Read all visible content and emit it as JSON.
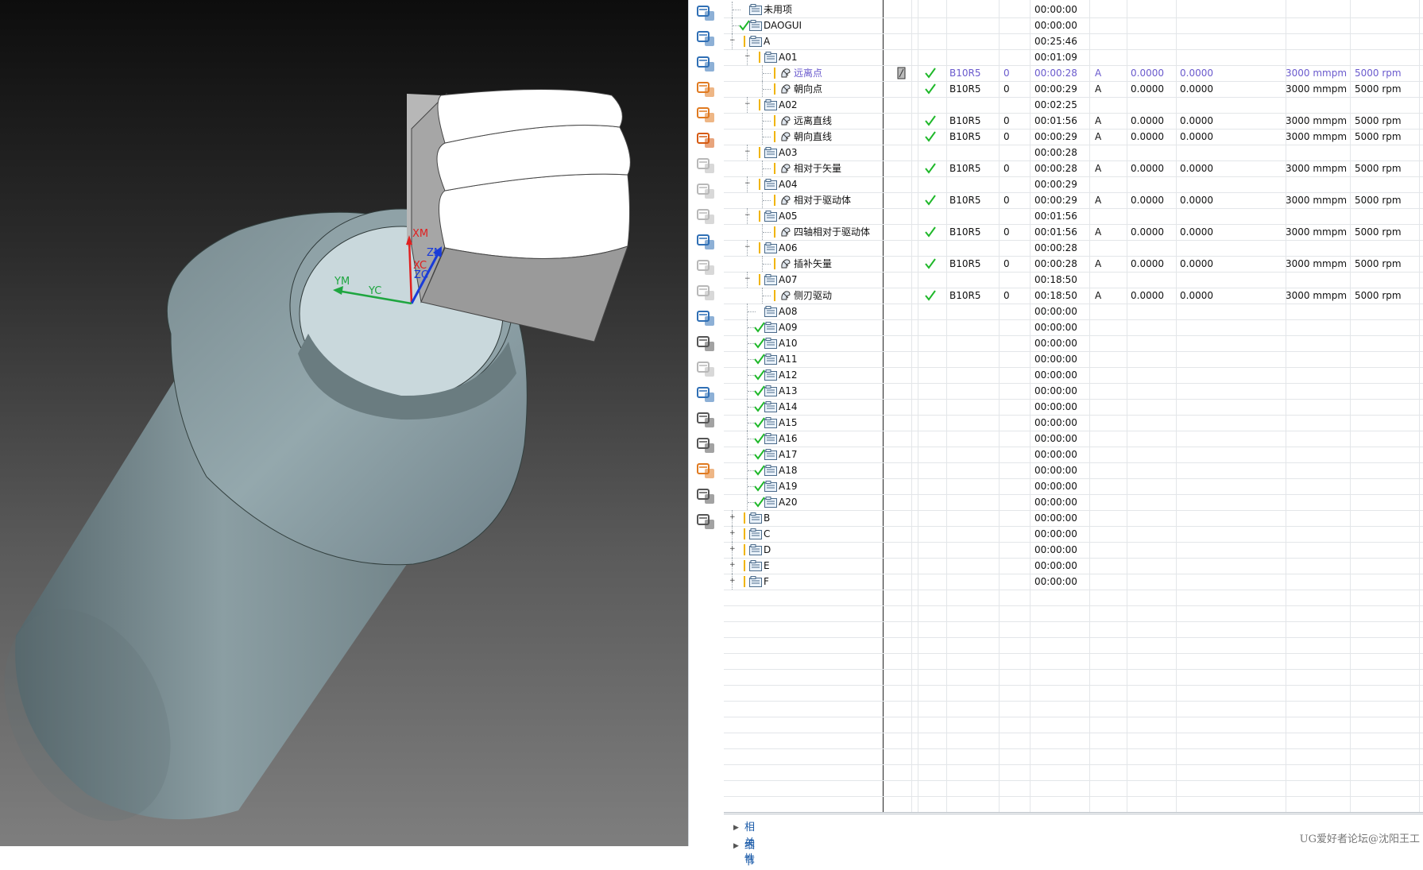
{
  "viewport": {
    "axes": {
      "xm": "XM",
      "xc": "XC",
      "zm": "ZM",
      "zc": "ZC",
      "ym": "YM",
      "yc": "YC"
    },
    "colors": {
      "x_axis": "#e02020",
      "y_axis": "#1fa640",
      "z_axis": "#1a3cd8",
      "part": "#7d9095",
      "tool": "#ffffff"
    }
  },
  "toolbar": {
    "items": [
      "create-program-icon",
      "create-tool-icon",
      "create-geometry-icon",
      "create-method-icon",
      "create-operation-icon",
      "new-operation-icon",
      "verify-toolpath-icon",
      "simulate-machine-icon",
      "wrench-icon",
      "generate-toolpath-icon",
      "replay-icon",
      "postprocess-icon",
      "shop-doc-icon",
      "edit-feed-icon",
      "transform-icon",
      "report-icon",
      "layout-icon",
      "save-icon",
      "display-icon",
      "hide-icon",
      "material-icon"
    ]
  },
  "navigator": {
    "rows": [
      {
        "name": "未用项",
        "type": "folder",
        "level": 0,
        "time": "00:00:00"
      },
      {
        "name": "DAOGUI",
        "type": "folder",
        "level": 0,
        "check": true,
        "time": "00:00:00"
      },
      {
        "name": "A",
        "type": "folder",
        "level": 0,
        "exp": "−",
        "ybar": true,
        "time": "00:25:46"
      },
      {
        "name": "A01",
        "type": "folder",
        "level": 1,
        "exp": "−",
        "ybar": true,
        "time": "00:01:09"
      },
      {
        "name": "远离点",
        "type": "op",
        "level": 2,
        "ybar": true,
        "sel": true,
        "edit": true,
        "ok": true,
        "tool": "B10R5",
        "num": "0",
        "time": "00:00:28",
        "geo": "A",
        "stock": "0.0000",
        "floor": "0.0000",
        "feed": "3000 mmpm",
        "speed": "5000 rpm"
      },
      {
        "name": "朝向点",
        "type": "op",
        "level": 2,
        "ybar": true,
        "ok": true,
        "tool": "B10R5",
        "num": "0",
        "time": "00:00:29",
        "geo": "A",
        "stock": "0.0000",
        "floor": "0.0000",
        "feed": "3000 mmpm",
        "speed": "5000 rpm"
      },
      {
        "name": "A02",
        "type": "folder",
        "level": 1,
        "exp": "−",
        "ybar": true,
        "time": "00:02:25"
      },
      {
        "name": "远离直线",
        "type": "op",
        "level": 2,
        "ybar": true,
        "ok": true,
        "tool": "B10R5",
        "num": "0",
        "time": "00:01:56",
        "geo": "A",
        "stock": "0.0000",
        "floor": "0.0000",
        "feed": "3000 mmpm",
        "speed": "5000 rpm"
      },
      {
        "name": "朝向直线",
        "type": "op",
        "level": 2,
        "ybar": true,
        "ok": true,
        "tool": "B10R5",
        "num": "0",
        "time": "00:00:29",
        "geo": "A",
        "stock": "0.0000",
        "floor": "0.0000",
        "feed": "3000 mmpm",
        "speed": "5000 rpm"
      },
      {
        "name": "A03",
        "type": "folder",
        "level": 1,
        "exp": "−",
        "ybar": true,
        "time": "00:00:28"
      },
      {
        "name": "相对于矢量",
        "type": "op",
        "level": 2,
        "ybar": true,
        "ok": true,
        "tool": "B10R5",
        "num": "0",
        "time": "00:00:28",
        "geo": "A",
        "stock": "0.0000",
        "floor": "0.0000",
        "feed": "3000 mmpm",
        "speed": "5000 rpm"
      },
      {
        "name": "A04",
        "type": "folder",
        "level": 1,
        "exp": "−",
        "ybar": true,
        "time": "00:00:29"
      },
      {
        "name": "相对于驱动体",
        "type": "op",
        "level": 2,
        "ybar": true,
        "ok": true,
        "tool": "B10R5",
        "num": "0",
        "time": "00:00:29",
        "geo": "A",
        "stock": "0.0000",
        "floor": "0.0000",
        "feed": "3000 mmpm",
        "speed": "5000 rpm"
      },
      {
        "name": "A05",
        "type": "folder",
        "level": 1,
        "exp": "−",
        "ybar": true,
        "time": "00:01:56"
      },
      {
        "name": "四轴相对于驱动体",
        "type": "op",
        "level": 2,
        "ybar": true,
        "ok": true,
        "tool": "B10R5",
        "num": "0",
        "time": "00:01:56",
        "geo": "A",
        "stock": "0.0000",
        "floor": "0.0000",
        "feed": "3000 mmpm",
        "speed": "5000 rpm"
      },
      {
        "name": "A06",
        "type": "folder",
        "level": 1,
        "exp": "−",
        "ybar": true,
        "time": "00:00:28"
      },
      {
        "name": "插补矢量",
        "type": "op",
        "level": 2,
        "ybar": true,
        "ok": true,
        "tool": "B10R5",
        "num": "0",
        "time": "00:00:28",
        "geo": "A",
        "stock": "0.0000",
        "floor": "0.0000",
        "feed": "3000 mmpm",
        "speed": "5000 rpm"
      },
      {
        "name": "A07",
        "type": "folder",
        "level": 1,
        "exp": "−",
        "ybar": true,
        "time": "00:18:50"
      },
      {
        "name": "侧刃驱动",
        "type": "op",
        "level": 2,
        "ybar": true,
        "ok": true,
        "tool": "B10R5",
        "num": "0",
        "time": "00:18:50",
        "geo": "A",
        "stock": "0.0000",
        "floor": "0.0000",
        "feed": "3000 mmpm",
        "speed": "5000 rpm"
      },
      {
        "name": "A08",
        "type": "folder",
        "level": 1,
        "time": "00:00:00"
      },
      {
        "name": "A09",
        "type": "folder",
        "level": 1,
        "check": true,
        "time": "00:00:00"
      },
      {
        "name": "A10",
        "type": "folder",
        "level": 1,
        "check": true,
        "time": "00:00:00"
      },
      {
        "name": "A11",
        "type": "folder",
        "level": 1,
        "check": true,
        "time": "00:00:00"
      },
      {
        "name": "A12",
        "type": "folder",
        "level": 1,
        "check": true,
        "time": "00:00:00"
      },
      {
        "name": "A13",
        "type": "folder",
        "level": 1,
        "check": true,
        "time": "00:00:00"
      },
      {
        "name": "A14",
        "type": "folder",
        "level": 1,
        "check": true,
        "time": "00:00:00"
      },
      {
        "name": "A15",
        "type": "folder",
        "level": 1,
        "check": true,
        "time": "00:00:00"
      },
      {
        "name": "A16",
        "type": "folder",
        "level": 1,
        "check": true,
        "time": "00:00:00"
      },
      {
        "name": "A17",
        "type": "folder",
        "level": 1,
        "check": true,
        "time": "00:00:00"
      },
      {
        "name": "A18",
        "type": "folder",
        "level": 1,
        "check": true,
        "time": "00:00:00"
      },
      {
        "name": "A19",
        "type": "folder",
        "level": 1,
        "check": true,
        "time": "00:00:00"
      },
      {
        "name": "A20",
        "type": "folder",
        "level": 1,
        "check": true,
        "time": "00:00:00"
      },
      {
        "name": "B",
        "type": "folder",
        "level": 0,
        "exp": "+",
        "ybar": true,
        "time": "00:00:00"
      },
      {
        "name": "C",
        "type": "folder",
        "level": 0,
        "exp": "+",
        "ybar": true,
        "time": "00:00:00"
      },
      {
        "name": "D",
        "type": "folder",
        "level": 0,
        "exp": "+",
        "ybar": true,
        "time": "00:00:00"
      },
      {
        "name": "E",
        "type": "folder",
        "level": 0,
        "exp": "+",
        "ybar": true,
        "time": "00:00:00"
      },
      {
        "name": "F",
        "type": "folder",
        "level": 0,
        "exp": "+",
        "ybar": true,
        "time": "00:00:00"
      }
    ],
    "sections": {
      "relevance": "相关性",
      "details": "细节"
    }
  },
  "watermark": "UG爱好者论坛@沈阳王工",
  "colors": {
    "selected_text": "#6a5acd",
    "check": "#1fb82a",
    "folder_tab": "#f0b400",
    "section_link": "#1a5aa8"
  }
}
